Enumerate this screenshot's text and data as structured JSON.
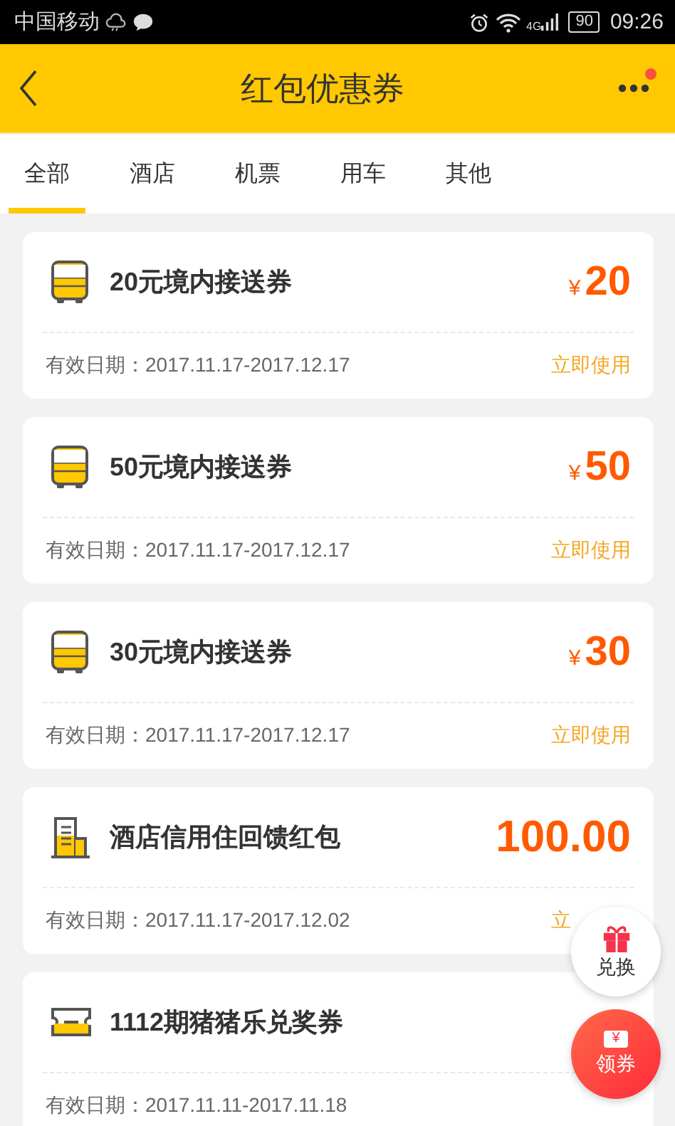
{
  "status_bar": {
    "carrier": "中国移动",
    "network": "4G",
    "battery": "90",
    "time": "09:26"
  },
  "header": {
    "title": "红包优惠券",
    "has_notification": true
  },
  "tabs": [
    {
      "label": "全部",
      "selected": true
    },
    {
      "label": "酒店",
      "selected": false
    },
    {
      "label": "机票",
      "selected": false
    },
    {
      "label": "用车",
      "selected": false
    },
    {
      "label": "其他",
      "selected": false
    }
  ],
  "coupons": [
    {
      "kind": "bus",
      "title": "20元境内接送券",
      "currency": "¥",
      "amount": "20",
      "validity": "有效日期：2017.11.17-2017.12.17",
      "action": "立即使用"
    },
    {
      "kind": "bus",
      "title": "50元境内接送券",
      "currency": "¥",
      "amount": "50",
      "validity": "有效日期：2017.11.17-2017.12.17",
      "action": "立即使用"
    },
    {
      "kind": "bus",
      "title": "30元境内接送券",
      "currency": "¥",
      "amount": "30",
      "validity": "有效日期：2017.11.17-2017.12.17",
      "action": "立即使用"
    },
    {
      "kind": "hotel",
      "title": "酒店信用住回馈红包",
      "amount": "100.00",
      "validity": "有效日期：2017.11.17-2017.12.02",
      "action": "立"
    },
    {
      "kind": "ticket",
      "title": "1112期猪猪乐兑奖券",
      "validity": "有效日期：2017.11.11-2017.11.18"
    }
  ],
  "floating_buttons": [
    {
      "kind": "gift",
      "label": "兑换"
    },
    {
      "kind": "coupon",
      "label": "领券",
      "icon_text": "¥"
    }
  ]
}
